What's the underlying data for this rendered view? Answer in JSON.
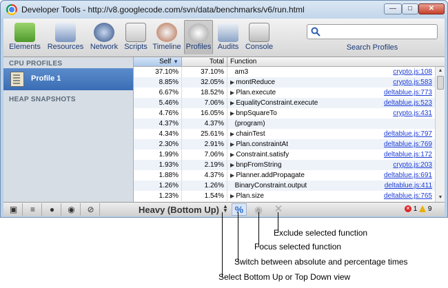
{
  "window": {
    "title": "Developer Tools - http://v8.googlecode.com/svn/data/benchmarks/v6/run.html"
  },
  "toolbar": {
    "items": [
      {
        "label": "Elements",
        "icon": "elements-icon",
        "color": "#6aa84f"
      },
      {
        "label": "Resources",
        "icon": "resources-icon",
        "color": "#5b7fb8"
      },
      {
        "label": "Network",
        "icon": "network-icon",
        "color": "#3a5a8c"
      },
      {
        "label": "Scripts",
        "icon": "scripts-icon",
        "color": "#c0504d"
      },
      {
        "label": "Timeline",
        "icon": "timeline-icon",
        "color": "#b45f3a"
      },
      {
        "label": "Profiles",
        "icon": "profiles-icon",
        "color": "#8e8e8e"
      },
      {
        "label": "Audits",
        "icon": "audits-icon",
        "color": "#5f7fa8"
      },
      {
        "label": "Console",
        "icon": "console-icon",
        "color": "#c0392b"
      }
    ],
    "active": "Profiles",
    "search_placeholder": "",
    "search_label": "Search Profiles"
  },
  "sidebar": {
    "cpu_title": "CPU PROFILES",
    "profile_label": "Profile 1",
    "heap_title": "HEAP SNAPSHOTS"
  },
  "grid": {
    "headers": {
      "self": "Self",
      "total": "Total",
      "function": "Function"
    },
    "rows": [
      {
        "self": "37.10%",
        "total": "37.10%",
        "func": "am3",
        "expand": false,
        "url": "crypto.js:108"
      },
      {
        "self": "8.85%",
        "total": "32.05%",
        "func": "montReduce",
        "expand": true,
        "url": "crypto.js:583"
      },
      {
        "self": "6.67%",
        "total": "18.52%",
        "func": "Plan.execute",
        "expand": true,
        "url": "deltablue.js:773"
      },
      {
        "self": "5.46%",
        "total": "7.06%",
        "func": "EqualityConstraint.execute",
        "expand": true,
        "url": "deltablue.js:523"
      },
      {
        "self": "4.76%",
        "total": "16.05%",
        "func": "bnpSquareTo",
        "expand": true,
        "url": "crypto.js:431"
      },
      {
        "self": "4.37%",
        "total": "4.37%",
        "func": "(program)",
        "expand": false,
        "url": ""
      },
      {
        "self": "4.34%",
        "total": "25.61%",
        "func": "chainTest",
        "expand": true,
        "url": "deltablue.js:797"
      },
      {
        "self": "2.30%",
        "total": "2.91%",
        "func": "Plan.constraintAt",
        "expand": true,
        "url": "deltablue.js:769"
      },
      {
        "self": "1.99%",
        "total": "7.06%",
        "func": "Constraint.satisfy",
        "expand": true,
        "url": "deltablue.js:172"
      },
      {
        "self": "1.93%",
        "total": "2.19%",
        "func": "bnpFromString",
        "expand": true,
        "url": "crypto.js:203"
      },
      {
        "self": "1.88%",
        "total": "4.37%",
        "func": "Planner.addPropagate",
        "expand": true,
        "url": "deltablue.js:691"
      },
      {
        "self": "1.26%",
        "total": "1.26%",
        "func": "BinaryConstraint.output",
        "expand": false,
        "url": "deltablue.js:411"
      },
      {
        "self": "1.23%",
        "total": "1.54%",
        "func": "Plan.size",
        "expand": true,
        "url": "deltablue.js:765"
      }
    ]
  },
  "statusbar": {
    "view_mode": "Heavy (Bottom Up)",
    "percent_symbol": "%",
    "error_count": "1",
    "warning_count": "9"
  },
  "callouts": {
    "exclude": "Exclude selected function",
    "focus": "Focus selected function",
    "switch": "Switch between absolute and percentage times",
    "select": "Select Bottom Up or Top Down view"
  }
}
